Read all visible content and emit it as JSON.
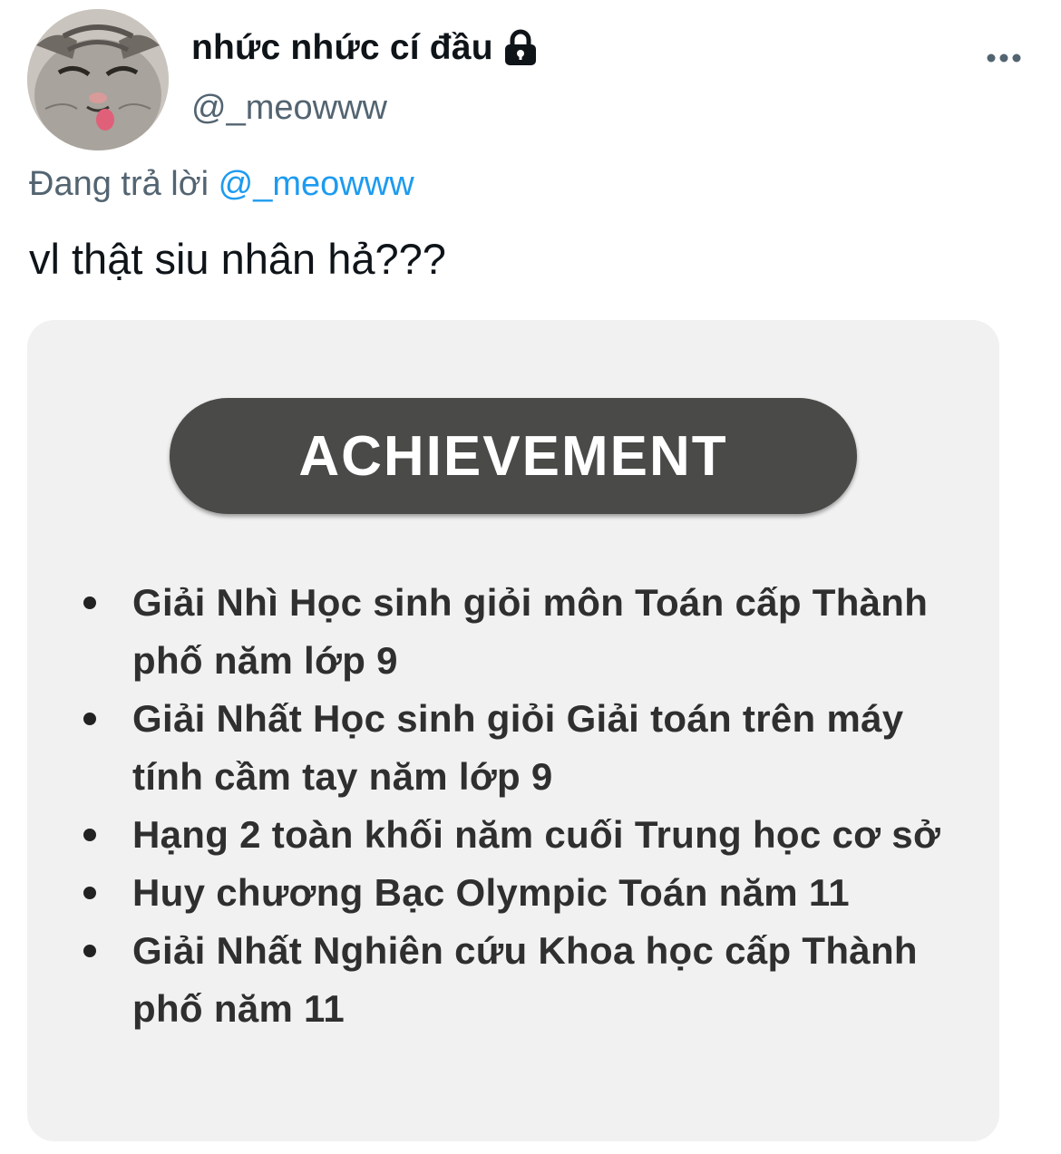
{
  "tweet": {
    "display_name": "nhức nhức cí đầu",
    "handle": "@_meowww",
    "protected_icon": "lock-icon",
    "more_icon": "more-dots-icon",
    "reply_prefix": "Đang trả lời",
    "reply_to": "@_meowww",
    "text": "vl thật siu nhân hả???"
  },
  "media": {
    "heading": "ACHIEVEMENT",
    "items": [
      "Giải Nhì Học sinh giỏi môn Toán cấp Thành phố năm lớp 9",
      "Giải Nhất Học sinh giỏi Giải toán trên máy tính cầm tay năm lớp 9",
      "Hạng 2 toàn khối năm cuối Trung học cơ sở",
      "Huy chương Bạc Olympic Toán năm 11",
      "Giải Nhất Nghiên cứu Khoa học cấp Thành phố năm 11"
    ]
  },
  "colors": {
    "text_primary": "#0f1419",
    "text_secondary": "#536471",
    "link": "#1d9bf0",
    "media_bg": "#f1f1f1",
    "pill_bg": "#4a4a48"
  }
}
